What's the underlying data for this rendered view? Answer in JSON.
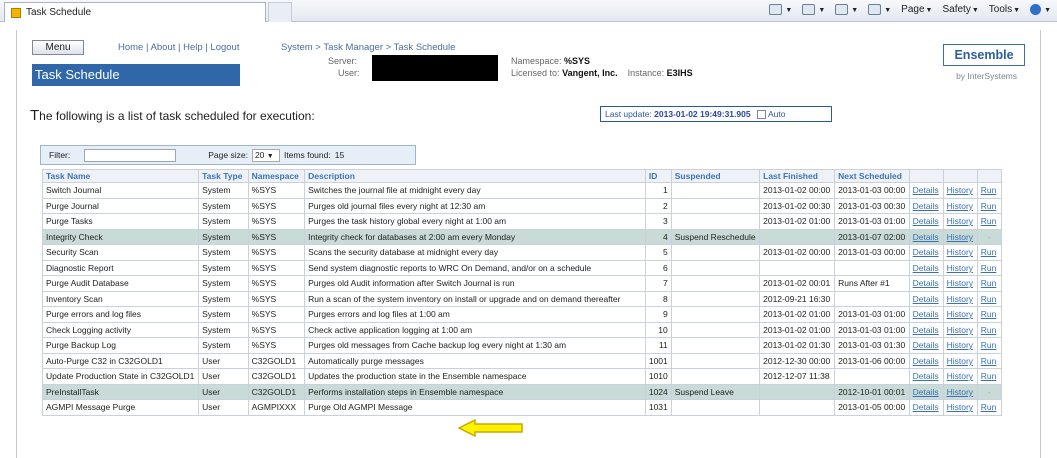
{
  "browser": {
    "tab_title": "Task Schedule",
    "commands": [
      "Page",
      "Safety",
      "Tools"
    ]
  },
  "header": {
    "menu_label": "Menu",
    "links": "Home | About | Help | Logout",
    "breadcrumb": "System > Task Manager > Task Schedule",
    "page_title": "Task Schedule",
    "server_label": "Server:",
    "user_label": "User:",
    "namespace_label": "Namespace:",
    "namespace_value": "%SYS",
    "licensed_label": "Licensed to:",
    "licensed_value": "Vangent, Inc.",
    "instance_label": "Instance:",
    "instance_value": "E3IHS",
    "brand": "Ensemble",
    "brand_by": "by InterSystems"
  },
  "list": {
    "title_initial": "T",
    "title_rest": "he following is a list of task scheduled for execution:",
    "last_update_label": "Last update:",
    "last_update_value": "2013-01-02 19:49:31.905",
    "auto_label": "Auto"
  },
  "filter": {
    "filter_label": "Filter:",
    "page_size_label": "Page size:",
    "page_size_value": "20",
    "items_found_label": "Items found:",
    "items_found_value": "15"
  },
  "table": {
    "columns": [
      "Task Name",
      "Task Type",
      "Namespace",
      "Description",
      "ID",
      "Suspended",
      "Last Finished",
      "Next Scheduled",
      "",
      "",
      ""
    ],
    "rows": [
      {
        "name": "Switch Journal",
        "type": "System",
        "ns": "%SYS",
        "desc": "Switches the journal file at midnight every day",
        "id": "1",
        "suspended": "",
        "last": "2013-01-02 00:00",
        "next": "2013-01-03 00:00",
        "details": "Details",
        "history": "History",
        "run": "Run",
        "disabled": false
      },
      {
        "name": "Purge Journal",
        "type": "System",
        "ns": "%SYS",
        "desc": "Purges old journal files every night at 12:30 am",
        "id": "2",
        "suspended": "",
        "last": "2013-01-02 00:30",
        "next": "2013-01-03 00:30",
        "details": "Details",
        "history": "History",
        "run": "Run",
        "disabled": false
      },
      {
        "name": "Purge Tasks",
        "type": "System",
        "ns": "%SYS",
        "desc": "Purges the task history global every night at 1:00 am",
        "id": "3",
        "suspended": "",
        "last": "2013-01-02 01:00",
        "next": "2013-01-03 01:00",
        "details": "Details",
        "history": "History",
        "run": "Run",
        "disabled": false
      },
      {
        "name": "Integrity Check",
        "type": "System",
        "ns": "%SYS",
        "desc": "Integrity check for databases at 2:00 am every Monday",
        "id": "4",
        "suspended": "Suspend Reschedule",
        "last": "",
        "next": "2013-01-07 02:00",
        "details": "Details",
        "history": "History",
        "run": "-",
        "disabled": true
      },
      {
        "name": "Security Scan",
        "type": "System",
        "ns": "%SYS",
        "desc": "Scans the security database at midnight every day",
        "id": "5",
        "suspended": "",
        "last": "2013-01-02 00:00",
        "next": "2013-01-03 00:00",
        "details": "Details",
        "history": "History",
        "run": "Run",
        "disabled": false
      },
      {
        "name": "Diagnostic Report",
        "type": "System",
        "ns": "%SYS",
        "desc": "Send system diagnostic reports to WRC On Demand, and/or on a schedule",
        "id": "6",
        "suspended": "",
        "last": "",
        "next": "",
        "details": "Details",
        "history": "History",
        "run": "Run",
        "disabled": false
      },
      {
        "name": "Purge Audit Database",
        "type": "System",
        "ns": "%SYS",
        "desc": "Purges old Audit information after Switch Journal is run",
        "id": "7",
        "suspended": "",
        "last": "2013-01-02 00:01",
        "next": "Runs After #1",
        "details": "Details",
        "history": "History",
        "run": "Run",
        "disabled": false
      },
      {
        "name": "Inventory Scan",
        "type": "System",
        "ns": "%SYS",
        "desc": "Run a scan of the system inventory on install or upgrade and on demand thereafter",
        "id": "8",
        "suspended": "",
        "last": "2012-09-21 16:30",
        "next": "",
        "details": "Details",
        "history": "History",
        "run": "Run",
        "disabled": false
      },
      {
        "name": "Purge errors and log files",
        "type": "System",
        "ns": "%SYS",
        "desc": "Purges errors and log files at 1:00 am",
        "id": "9",
        "suspended": "",
        "last": "2013-01-02 01:00",
        "next": "2013-01-03 01:00",
        "details": "Details",
        "history": "History",
        "run": "Run",
        "disabled": false
      },
      {
        "name": "Check Logging activity",
        "type": "System",
        "ns": "%SYS",
        "desc": "Check active application logging at 1:00 am",
        "id": "10",
        "suspended": "",
        "last": "2013-01-02 01:00",
        "next": "2013-01-03 01:00",
        "details": "Details",
        "history": "History",
        "run": "Run",
        "disabled": false
      },
      {
        "name": "Purge Backup Log",
        "type": "System",
        "ns": "%SYS",
        "desc": "Purges old messages from Cache backup log every night at 1:30 am",
        "id": "11",
        "suspended": "",
        "last": "2013-01-02 01:30",
        "next": "2013-01-03 01:30",
        "details": "Details",
        "history": "History",
        "run": "Run",
        "disabled": false
      },
      {
        "name": "Auto-Purge C32 in C32GOLD1",
        "type": "User",
        "ns": "C32GOLD1",
        "desc": "Automatically purge messages",
        "id": "1001",
        "suspended": "",
        "last": "2012-12-30 00:00",
        "next": "2013-01-06 00:00",
        "details": "Details",
        "history": "History",
        "run": "Run",
        "disabled": false
      },
      {
        "name": "Update Production State in C32GOLD1",
        "type": "User",
        "ns": "C32GOLD1",
        "desc": "Updates the production state in the Ensemble namespace",
        "id": "1010",
        "suspended": "",
        "last": "2012-12-07 11:38",
        "next": "",
        "details": "Details",
        "history": "History",
        "run": "Run",
        "disabled": false
      },
      {
        "name": "PreInstallTask",
        "type": "User",
        "ns": "C32GOLD1",
        "desc": "Performs installation steps in Ensemble namespace",
        "id": "1024",
        "suspended": "Suspend Leave",
        "last": "",
        "next": "2012-10-01 00:01",
        "details": "Details",
        "history": "History",
        "run": "-",
        "disabled": true
      },
      {
        "name": "AGMPI Message Purge",
        "type": "User",
        "ns": "AGMPIXXX",
        "desc": "Purge Old AGMPI Message",
        "id": "1031",
        "suspended": "",
        "last": "",
        "next": "2013-01-05 00:00",
        "details": "Details",
        "history": "History",
        "run": "Run",
        "disabled": false
      }
    ]
  },
  "colors": {
    "accent": "#2f67a8",
    "disabled_row": "#c8dbd6",
    "arrow_fill": "#fff200",
    "arrow_stroke": "#c9a800"
  }
}
